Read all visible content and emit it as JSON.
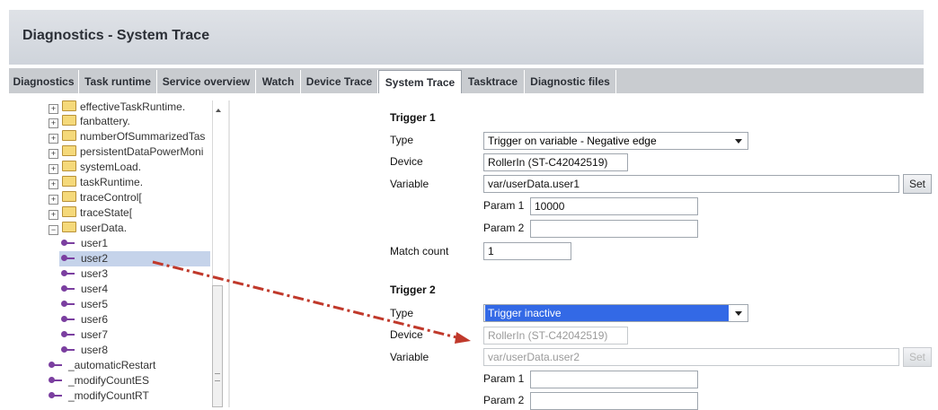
{
  "page": {
    "title": "Diagnostics - System Trace"
  },
  "tabs": [
    {
      "label": "Diagnostics"
    },
    {
      "label": "Task runtime"
    },
    {
      "label": "Service overview"
    },
    {
      "label": "Watch"
    },
    {
      "label": "Device Trace"
    },
    {
      "label": "System Trace",
      "active": true
    },
    {
      "label": "Tasktrace"
    },
    {
      "label": "Diagnostic files"
    }
  ],
  "tree": {
    "items": [
      {
        "label": "effectiveTaskRuntime.",
        "kind": "folder"
      },
      {
        "label": "fanbattery.",
        "kind": "folder"
      },
      {
        "label": "numberOfSummarizedTas",
        "kind": "folder"
      },
      {
        "label": "persistentDataPowerMoni",
        "kind": "folder"
      },
      {
        "label": "systemLoad.",
        "kind": "folder"
      },
      {
        "label": "taskRuntime.",
        "kind": "folder"
      },
      {
        "label": "traceControl[",
        "kind": "folder"
      },
      {
        "label": "traceState[",
        "kind": "folder"
      },
      {
        "label": "userData.",
        "kind": "folder",
        "expanded": true
      },
      {
        "label": "user1",
        "kind": "variable"
      },
      {
        "label": "user2",
        "kind": "variable",
        "selected": true
      },
      {
        "label": "user3",
        "kind": "variable"
      },
      {
        "label": "user4",
        "kind": "variable"
      },
      {
        "label": "user5",
        "kind": "variable"
      },
      {
        "label": "user6",
        "kind": "variable"
      },
      {
        "label": "user7",
        "kind": "variable"
      },
      {
        "label": "user8",
        "kind": "variable"
      },
      {
        "label": "_automaticRestart",
        "kind": "variable"
      },
      {
        "label": "_modifyCountES",
        "kind": "variable"
      },
      {
        "label": "_modifyCountRT",
        "kind": "variable"
      }
    ],
    "expander_collapsed": "+",
    "expander_expanded": "−"
  },
  "trigger1": {
    "heading": "Trigger 1",
    "type_label": "Type",
    "type_value": "Trigger on variable - Negative edge",
    "device_label": "Device",
    "device_value": "RollerIn (ST-C42042519)",
    "variable_label": "Variable",
    "variable_value": "var/userData.user1",
    "set_label": "Set",
    "param1_label": "Param 1",
    "param1_value": "10000",
    "param2_label": "Param 2",
    "param2_value": "",
    "match_label": "Match count",
    "match_value": "1"
  },
  "trigger2": {
    "heading": "Trigger 2",
    "type_label": "Type",
    "type_value": "Trigger inactive",
    "device_label": "Device",
    "device_value": "RollerIn (ST-C42042519)",
    "variable_label": "Variable",
    "variable_value": "var/userData.user2",
    "set_label": "Set",
    "param1_label": "Param 1",
    "param1_value": "",
    "param2_label": "Param 2",
    "param2_value": ""
  },
  "colors": {
    "annotation_arrow": "#c0392b",
    "selection": "#c5d3ea",
    "dropdown_highlight": "#3369e6",
    "variable_icon": "#7b3fa0"
  }
}
